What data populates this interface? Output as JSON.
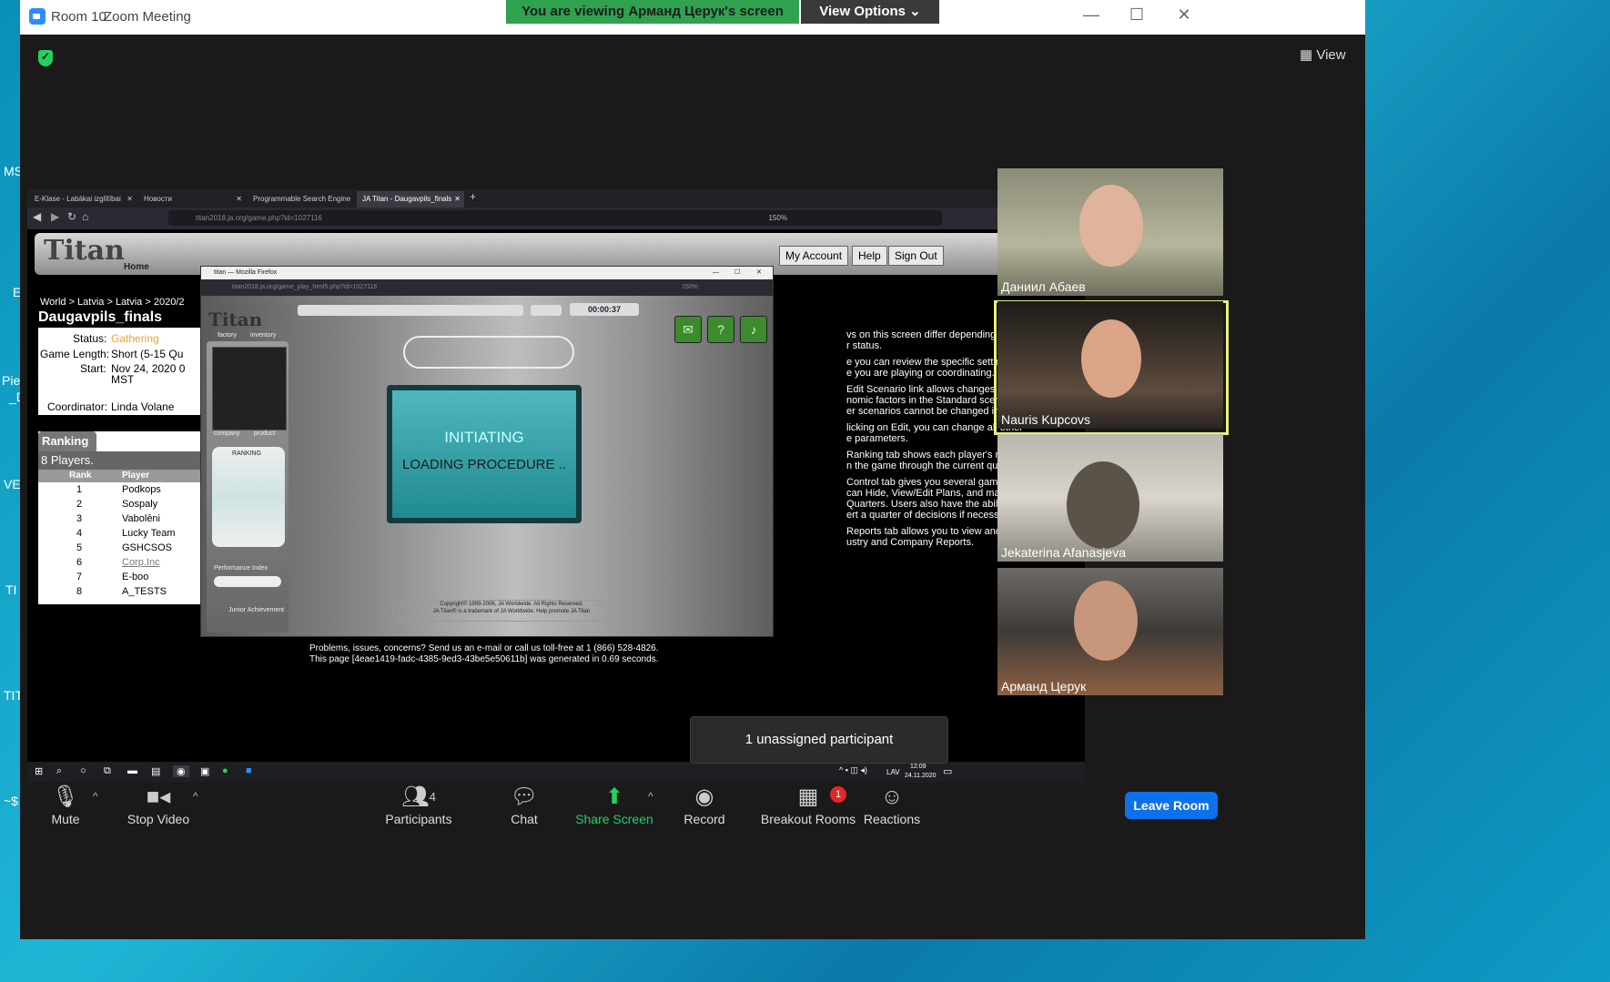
{
  "window": {
    "app_name": "Room 10",
    "title": "Zoom Meeting"
  },
  "banner": {
    "viewing_text": "You are viewing Арманд Церук's screen",
    "view_options": "View Options"
  },
  "view_button": "View",
  "browser": {
    "tabs": [
      "E-Klase - Labākai izglītībai",
      "Новости",
      "Programmable Search Engine",
      "JA Titan - Daugavpils_finals"
    ],
    "url": "titan2018.ja.org/game.php?id=1027116",
    "zoom": "150%"
  },
  "titan": {
    "logo": "Titan",
    "home": "Home",
    "nav": [
      "My Account",
      "Help",
      "Sign Out"
    ],
    "breadcrumb": "World > Latvia > Latvia > 2020/2",
    "game_title": "Daugavpils_finals",
    "status_label": "Status:",
    "status_value": "Gathering",
    "length_label": "Game Length:",
    "length_value": "Short (5-15 Qu",
    "start_label": "Start:",
    "start_value": "Nov 24, 2020 0",
    "start_tz": "MST",
    "coord_label": "Coordinator:",
    "coord_value": "Linda Volane",
    "ranking_tab": "Ranking",
    "players_count": "8 Players.",
    "rank_head": "Rank",
    "player_head": "Player",
    "ranking": [
      {
        "rank": "1",
        "player": "Podkops"
      },
      {
        "rank": "2",
        "player": "Sospaly"
      },
      {
        "rank": "3",
        "player": "Vabolēni"
      },
      {
        "rank": "4",
        "player": "Lucky Team"
      },
      {
        "rank": "5",
        "player": "GSHCSOS"
      },
      {
        "rank": "6",
        "player": "Corp.Inc"
      },
      {
        "rank": "7",
        "player": "E-boo"
      },
      {
        "rank": "8",
        "player": "A_TESTS"
      }
    ],
    "help_lines": [
      "vs on this screen differ depending on your",
      "r status.",
      "",
      "e you can review the specific settings of a",
      "e you are playing or coordinating.",
      "",
      "Edit Scenario link allows changes to certain",
      "nomic factors in the Standard scenario.",
      "er scenarios cannot be changed in this way.",
      "",
      "licking on Edit, you can change all other",
      "e parameters.",
      "",
      "Ranking tab shows each player's rank",
      "n the game through the current quarter.",
      "",
      "Control tab gives you several game options.",
      "can Hide, View/Edit Plans, and manually",
      "Quarters. Users also have the ability to",
      "ert a quarter of decisions if necessary.",
      "",
      "Reports tab allows you to view and print",
      "ustry and Company Reports."
    ],
    "footer1": "Problems, issues, concerns? Send us an e-mail or call us toll-free at 1 (866) 528-4826.",
    "footer2": "This page [4eae1419-fadc-4385-9ed3-43be5e50611b] was generated in 0.69 seconds."
  },
  "popup": {
    "title": "titan — Mozilla Firefox",
    "url": "titan2018.ja.org/game_play_html5.php?id=1027116",
    "zoom": "150%",
    "logo": "Titan",
    "tab_factory": "factory",
    "tab_inventory": "inventory",
    "tab_company": "company",
    "tab_product": "product",
    "ranking_label": "RANKING",
    "perf_label": "Performance Index",
    "timer": "00:00:37",
    "initiating": "INITIATING",
    "loading": "LOADING PROCEDURE ..",
    "ja_logo": "Junior Achievement",
    "copyright1": "Copyright© 1999-2006, JA Worldwide. All Rights Reserved.",
    "copyright2": "JA Titan® is a trademark of JA Worldwide. Help promote JA Titan"
  },
  "taskbar": {
    "lang": "LAV",
    "time": "12:09",
    "date": "24.11.2020"
  },
  "participants": [
    {
      "name": "Даниил Абаев"
    },
    {
      "name": "Nauris Kupcovs"
    },
    {
      "name": "Jekaterina Afanasjeva"
    },
    {
      "name": "Арманд Церук"
    }
  ],
  "toast": "1 unassigned participant",
  "toolbar": {
    "mute": "Mute",
    "stop_video": "Stop Video",
    "participants": "Participants",
    "participants_count": "4",
    "chat": "Chat",
    "share_screen": "Share Screen",
    "record": "Record",
    "breakout_rooms": "Breakout Rooms",
    "breakout_badge": "1",
    "reactions": "Reactions",
    "leave": "Leave Room"
  },
  "desktop_labels": [
    "MS",
    "E",
    "Pie",
    "_D",
    "VE",
    "TI",
    "TIT",
    "~$"
  ],
  "colors": {
    "accent": "#2d8cff",
    "banner_green": "#30a14e",
    "leave_blue": "#0e71eb",
    "share_green": "#23d160",
    "status_gathering": "#e8a53a"
  }
}
